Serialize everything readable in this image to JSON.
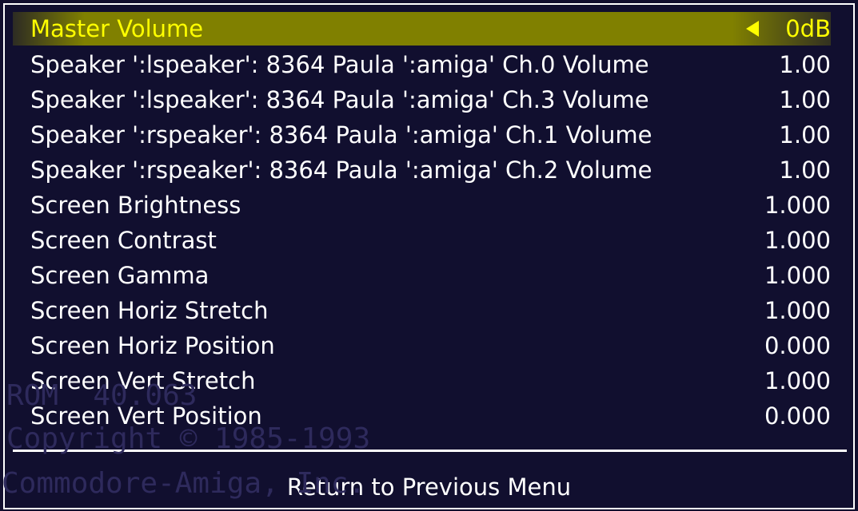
{
  "background_text": [
    "ROM  40.063",
    "Copyright © 1985-1993",
    "Commodore-Amiga, Inc."
  ],
  "menu": {
    "items": [
      {
        "label": "Master Volume",
        "value": "0dB",
        "selected": true
      },
      {
        "label": "Speaker ':lspeaker': 8364 Paula ':amiga' Ch.0 Volume",
        "value": "1.00"
      },
      {
        "label": "Speaker ':lspeaker': 8364 Paula ':amiga' Ch.3 Volume",
        "value": "1.00"
      },
      {
        "label": "Speaker ':rspeaker': 8364 Paula ':amiga' Ch.1 Volume",
        "value": "1.00"
      },
      {
        "label": "Speaker ':rspeaker': 8364 Paula ':amiga' Ch.2 Volume",
        "value": "1.00"
      },
      {
        "label": "Screen Brightness",
        "value": "1.000"
      },
      {
        "label": "Screen Contrast",
        "value": "1.000"
      },
      {
        "label": "Screen Gamma",
        "value": "1.000"
      },
      {
        "label": "Screen Horiz Stretch",
        "value": "1.000"
      },
      {
        "label": "Screen Horiz Position",
        "value": "0.000"
      },
      {
        "label": "Screen Vert Stretch",
        "value": "1.000"
      },
      {
        "label": "Screen Vert Position",
        "value": "0.000"
      }
    ],
    "return_label": "Return to Previous Menu"
  },
  "colors": {
    "background": "#120f2e",
    "selected_bg": "#808000",
    "selected_text": "#ffff00",
    "text": "#ffffff"
  },
  "icons": {
    "selected_arrow": "triangle-left-icon"
  }
}
